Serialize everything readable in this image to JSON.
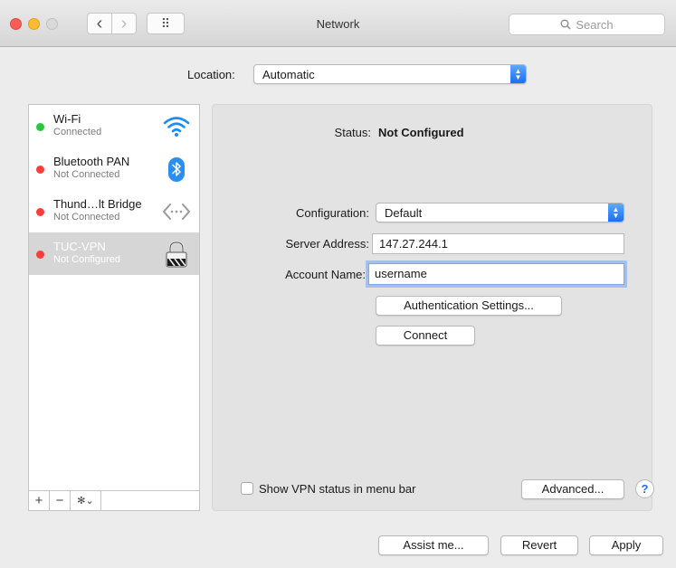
{
  "window": {
    "title": "Network",
    "search_placeholder": "Search",
    "back_glyph": "‹",
    "forward_glyph": "›",
    "grid_glyph": "⠿"
  },
  "location": {
    "label": "Location:",
    "value": "Automatic"
  },
  "services": [
    {
      "name": "Wi-Fi",
      "status": "Connected",
      "dot_color": "#28c940",
      "icon": "wifi-icon"
    },
    {
      "name": "Bluetooth PAN",
      "status": "Not Connected",
      "dot_color": "#fc3d39",
      "icon": "bluetooth-icon"
    },
    {
      "name": "Thund…lt Bridge",
      "status": "Not Connected",
      "dot_color": "#fc3d39",
      "icon": "thunderbolt-bridge-icon"
    },
    {
      "name": "TUC-VPN",
      "status": "Not Configured",
      "dot_color": "#fc3d39",
      "icon": "vpn-lock-icon",
      "selected": true
    }
  ],
  "sidebar_toolbar": {
    "add": "+",
    "remove": "−",
    "gear": "✻⌄"
  },
  "detail": {
    "status_label": "Status:",
    "status_value": "Not Configured",
    "configuration_label": "Configuration:",
    "configuration_value": "Default",
    "server_label": "Server Address:",
    "server_value": "147.27.244.1",
    "account_label": "Account Name:",
    "account_value": "username",
    "auth_button": "Authentication Settings...",
    "connect_button": "Connect",
    "show_vpn_label": "Show VPN status in menu bar",
    "show_vpn_checked": false,
    "advanced_button": "Advanced...",
    "help": "?"
  },
  "footer": {
    "assist_button": "Assist me...",
    "revert_button": "Revert",
    "apply_button": "Apply"
  },
  "colors": {
    "accent": "#1f6df2",
    "selected_row": "#d6d6d6"
  }
}
